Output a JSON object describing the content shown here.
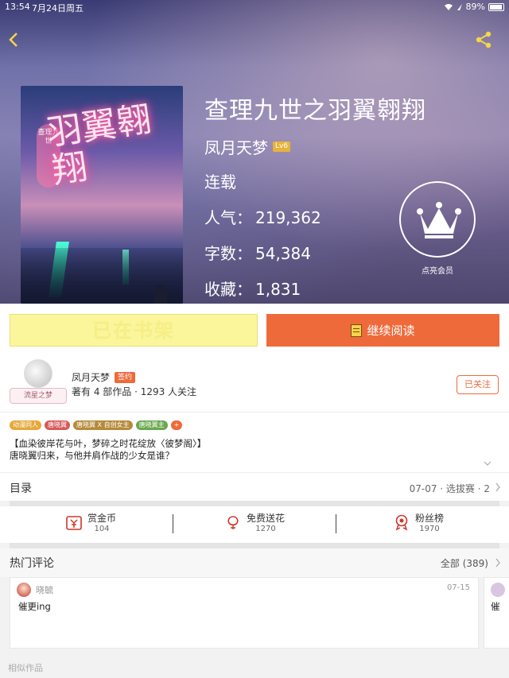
{
  "status_bar": {
    "time": "13:54",
    "date": "7月24日周五",
    "battery": "89%"
  },
  "book": {
    "title": "查理九世之羽翼翱翔",
    "author": "凤月天梦",
    "level": "Lv6",
    "status": "连载",
    "popularity_label": "人气：",
    "popularity": "219,362",
    "words_label": "字数：",
    "words": "54,384",
    "favorites_label": "收藏：",
    "favorites": "1,831",
    "cover_text": "羽翼翱翔",
    "cover_badge": "查理九世"
  },
  "vip": {
    "label": "点亮会员"
  },
  "actions": {
    "shelf": "已在书架",
    "read": "继续阅读"
  },
  "author_info": {
    "name": "凤月天梦",
    "sign_badge": "签约",
    "stats": "著有 4 部作品 · 1293 人关注",
    "frame_text": "流星之梦",
    "follow": "已关注"
  },
  "tags": [
    {
      "label": "动漫同人",
      "color": "#e6a83a"
    },
    {
      "label": "唐晓翼",
      "color": "#d65a5a"
    },
    {
      "label": "唐晓翼 X 自创女主",
      "color": "#b58a3a"
    },
    {
      "label": "唐晓翼主",
      "color": "#6aa84f"
    },
    {
      "label": "+",
      "color": "#ee6a3b"
    }
  ],
  "synopsis": [
    "【血染彼岸花与叶，梦碎之时花绽放〈彼梦阁〉】",
    "唐晓翼归来，与他并肩作战的少女是谁？"
  ],
  "catalog": {
    "title": "目录",
    "latest": "07-07 · 选拔赛 · 2"
  },
  "rewards": [
    {
      "label": "赏金币",
      "value": "104",
      "icon": "coin-icon"
    },
    {
      "label": "免费送花",
      "value": "1270",
      "icon": "flower-icon"
    },
    {
      "label": "粉丝榜",
      "value": "1970",
      "icon": "medal-icon"
    }
  ],
  "comments": {
    "title": "热门评论",
    "all": "全部 (389)",
    "items": [
      {
        "user": "晓毓",
        "date": "07-15",
        "text": "催更ing"
      },
      {
        "text": "催"
      }
    ]
  },
  "similar": "相似作品",
  "colors": {
    "accent": "#ee6a3b",
    "shelf": "#fbf59b"
  }
}
